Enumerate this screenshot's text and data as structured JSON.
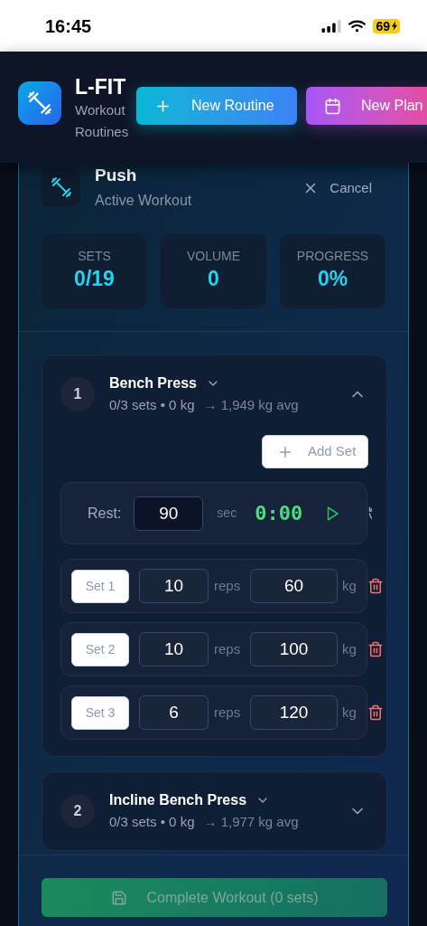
{
  "status_bar": {
    "time": "16:45",
    "battery": "69"
  },
  "header": {
    "title": "L-FIT",
    "subtitle": "Workout Routines",
    "buttons": [
      {
        "label": "New Routine",
        "kind": "routine"
      },
      {
        "label": "New Plan",
        "kind": "plan"
      }
    ]
  },
  "workout": {
    "title": "Push",
    "subtitle": "Active Workout",
    "cancel": "Cancel",
    "stats": [
      {
        "label": "SETS",
        "value": "0/19"
      },
      {
        "label": "VOLUME",
        "value": "0"
      },
      {
        "label": "PROGRESS",
        "value": "0%"
      }
    ],
    "exercises": [
      {
        "number": "1",
        "name": "Bench Press",
        "summary": "0/3 sets • 0 kg",
        "average": "→ 1,949 kg avg",
        "expanded": true,
        "add_set": "Add Set",
        "rest": {
          "label": "Rest:",
          "value": "90",
          "unit": "sec",
          "timer": "0:00"
        },
        "sets": [
          {
            "label": "Set 1",
            "reps": "10",
            "reps_unit": "reps",
            "weight": "60",
            "weight_unit": "kg"
          },
          {
            "label": "Set 2",
            "reps": "10",
            "reps_unit": "reps",
            "weight": "100",
            "weight_unit": "kg"
          },
          {
            "label": "Set 3",
            "reps": "6",
            "reps_unit": "reps",
            "weight": "120",
            "weight_unit": "kg"
          }
        ]
      },
      {
        "number": "2",
        "name": "Incline Bench Press",
        "summary": "0/3 sets • 0 kg",
        "average": "→ 1,977 kg avg",
        "expanded": false
      }
    ],
    "complete_button": {
      "label": "Complete Workout (0 sets)",
      "disabled": true
    }
  }
}
